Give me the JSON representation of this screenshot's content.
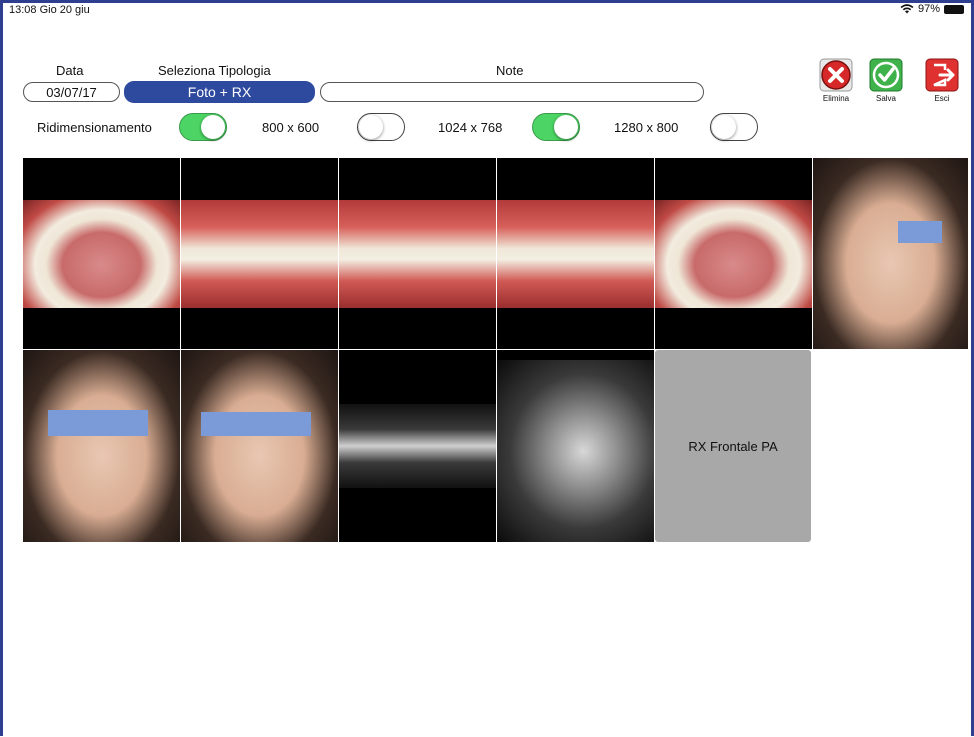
{
  "status": {
    "time": "13:08  Gio 20 giu",
    "battery": "97%"
  },
  "form": {
    "date_label": "Data",
    "date_value": "03/07/17",
    "type_label": "Seleziona Tipologia",
    "type_value": "Foto + RX",
    "note_label": "Note",
    "note_value": ""
  },
  "resize": {
    "label": "Ridimensionamento",
    "enabled": true,
    "options": [
      {
        "label": "800 x 600",
        "on": false
      },
      {
        "label": "1024 x 768",
        "on": true
      },
      {
        "label": "1280 x 800",
        "on": false
      }
    ]
  },
  "actions": [
    {
      "label": "Elimina",
      "color": "#d62828",
      "icon": "x-icon"
    },
    {
      "label": "Salva",
      "color": "#36b34a",
      "icon": "check-icon"
    },
    {
      "label": "Esci",
      "color": "#e03131",
      "icon": "exit-icon"
    }
  ],
  "gallery": {
    "placeholder_label": "RX Frontale PA"
  }
}
